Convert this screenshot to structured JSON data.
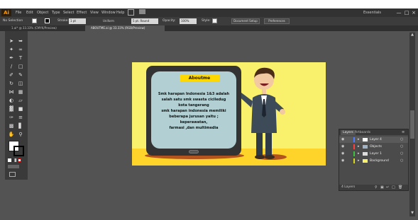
{
  "app": {
    "logo": "Ai",
    "menu": [
      "File",
      "Edit",
      "Object",
      "Type",
      "Select",
      "Effect",
      "View",
      "Window",
      "Help"
    ],
    "workspace": "Essentials",
    "window_buttons": [
      "—",
      "□",
      "×"
    ]
  },
  "control_bar": {
    "selection_label": "No Selection",
    "stroke_label": "Stroke:",
    "stroke_value": "1 pt",
    "brush_value": "Uniform",
    "basic_label": "5 pt. Round",
    "opacity_label": "Opacity:",
    "opacity_value": "100%",
    "style_label": "Style:",
    "doc_setup_button": "Document Setup",
    "preferences_button": "Preferences"
  },
  "tabs": [
    {
      "label": "1.ai* @ 33.33% (CMYK/Preview)",
      "active": false
    },
    {
      "label": "ABOUTME.ai @ 33.33% (RGB/Preview)",
      "active": true
    }
  ],
  "artboard": {
    "title": "Aboutme",
    "bio": "Smk harapan Indonesia 1&3 adalah\nsalah satu smk swasta ciciledug\nkota tangerang\nsmk harapan indonesia memiliki\nbeberapa jurusan yaitu ;\nkeperawatan,\nfarmasi ,dan multimedia",
    "colors": {
      "background": "#f9f06c",
      "floor": "#ffd42a",
      "phone": "#333333",
      "screen": "#b2d0d3",
      "banner": "#ffd800"
    }
  },
  "layers_panel": {
    "tabs": [
      "Layers",
      "Artboards"
    ],
    "layers": [
      "Layer 4",
      "Objects",
      "Layer 1",
      "Background"
    ],
    "layer_colors": [
      "#4f7bff",
      "#ff4040",
      "#40c040",
      "#d6d626"
    ],
    "footer_count": "4 Layers"
  }
}
